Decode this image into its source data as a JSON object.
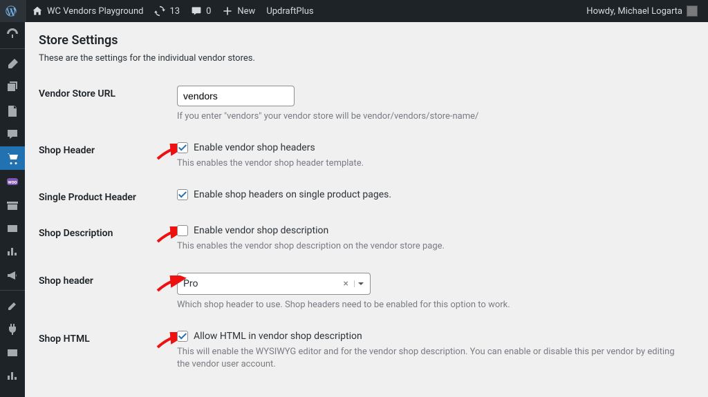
{
  "adminbar": {
    "site": "WC Vendors Playground",
    "updates_count": "13",
    "comments_count": "0",
    "new_label": "New",
    "updraft_label": "UpdraftPlus",
    "howdy": "Howdy, Michael Logarta"
  },
  "page": {
    "title": "Store Settings",
    "intro": "These are the settings for the individual vendor stores."
  },
  "fields": {
    "store_url": {
      "label": "Vendor Store URL",
      "value": "vendors",
      "help": "If you enter \"vendors\" your vendor store will be vendor/vendors/store-name/"
    },
    "shop_header": {
      "label": "Shop Header",
      "checkbox_label": "Enable vendor shop headers",
      "checked": true,
      "help": "This enables the vendor shop header template."
    },
    "single_product_header": {
      "label": "Single Product Header",
      "checkbox_label": "Enable shop headers on single product pages.",
      "checked": true
    },
    "shop_description": {
      "label": "Shop Description",
      "checkbox_label": "Enable vendor shop description",
      "checked": false,
      "help": "This enables the vendor shop description on the vendor store page."
    },
    "shop_header_select": {
      "label": "Shop header",
      "value": "Pro",
      "clear": "×",
      "help": "Which shop header to use. Shop headers need to be enabled for this option to work."
    },
    "shop_html": {
      "label": "Shop HTML",
      "checkbox_label": "Allow HTML in vendor shop description",
      "checked": true,
      "help": "This will enable the WYSIWYG editor and for the vendor shop description. You can enable or disable this per vendor by editing the vendor user account."
    }
  }
}
